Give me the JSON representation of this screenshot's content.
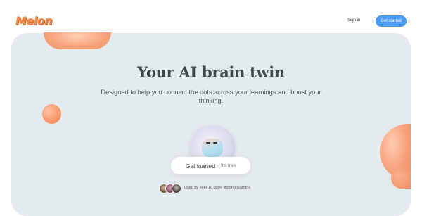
{
  "header": {
    "logo_text": "Melon",
    "signin_label": "Sign in",
    "cta_label": "Get started",
    "accent_color": "#4b9bf0"
  },
  "hero": {
    "title": "Your AI brain twin",
    "subtitle": "Designed to help you connect the dots across your learnings and boost your thinking.",
    "cta_label": "Get started",
    "cta_separator": "-",
    "cta_note": "It's free",
    "social_proof": "Used by over 10,000+ lifelong learners",
    "mascot": "melon-mascot",
    "avatar_count": 3
  }
}
